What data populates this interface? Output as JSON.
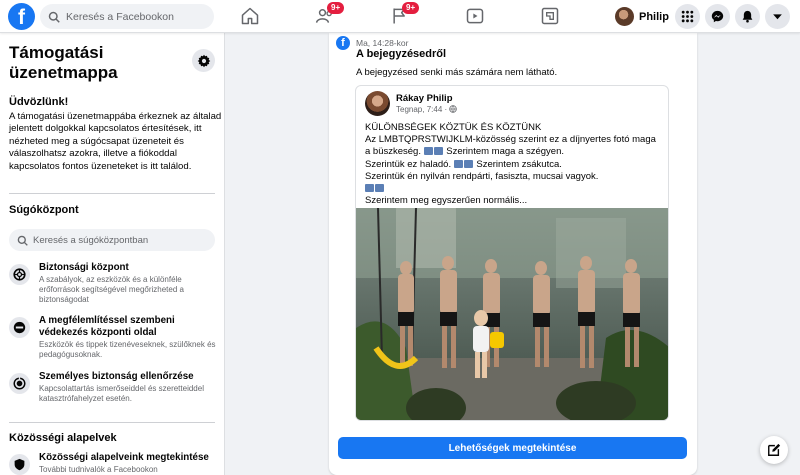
{
  "topbar": {
    "search_placeholder": "Keresés a Facebookon",
    "friends_badge": "9+",
    "pages_badge": "9+",
    "profile_name": "Philip"
  },
  "sidebar": {
    "title": "Támogatási üzenetmappa",
    "welcome": "Üdvözlünk!",
    "intro": "A támogatási üzenetmappába érkeznek az általad jelentett dolgokkal kapcsolatos értesítések, itt nézheted meg a súgócsapat üzeneteit és válaszolhatsz azokra, illetve a fiókoddal kapcsolatos fontos üzeneteket is itt találod.",
    "help_center_heading": "Súgóközpont",
    "help_search_placeholder": "Keresés a súgóközpontban",
    "items": [
      {
        "title": "Biztonsági központ",
        "desc": "A szabályok, az eszközök és a különféle erőforrások segítségével megőrizheted a biztonságodat"
      },
      {
        "title": "A megfélemlítéssel szembeni védekezés központi oldal",
        "desc": "Eszközök és tippek tizenéveseknek, szülőknek és pedagógusoknak."
      },
      {
        "title": "Személyes biztonság ellenőrzése",
        "desc": "Kapcsolattartás ismerőseiddel és szeretteiddel katasztrófahelyzet esetén."
      }
    ],
    "community_heading": "Közösségi alapelvek",
    "community_item": {
      "title": "Közösségi alapelveink megtekintése",
      "desc": "További tudnivalók a Facebookon"
    }
  },
  "message": {
    "time": "Ma, 14:28-kor",
    "title": "A bejegyzésedről",
    "body": "A bejegyzésed senki más számára nem látható.",
    "post": {
      "author": "Rákay Philip",
      "time": "Tegnap, 7:44 · ",
      "lines": [
        "KÜLÖNBSÉGEK KÖZTÜK ÉS KÖZTÜNK",
        "Az LMBTQPRSTWIJKLM-közösség szerint ez a díjnyertes fotó maga",
        "a büszkeség.",
        "Szerintem maga a szégyen.",
        "Szerintük ez haladó.",
        "Szerintem zsákutca.",
        "Szerintük én nyilván rendpárti, fasiszta, mucsai vagyok.",
        "Szerintem meg egyszerűen normális..."
      ]
    },
    "button_label": "Lehetőségek megtekintése"
  },
  "colors": {
    "brand": "#1877f2",
    "badge": "#e41e3f"
  }
}
